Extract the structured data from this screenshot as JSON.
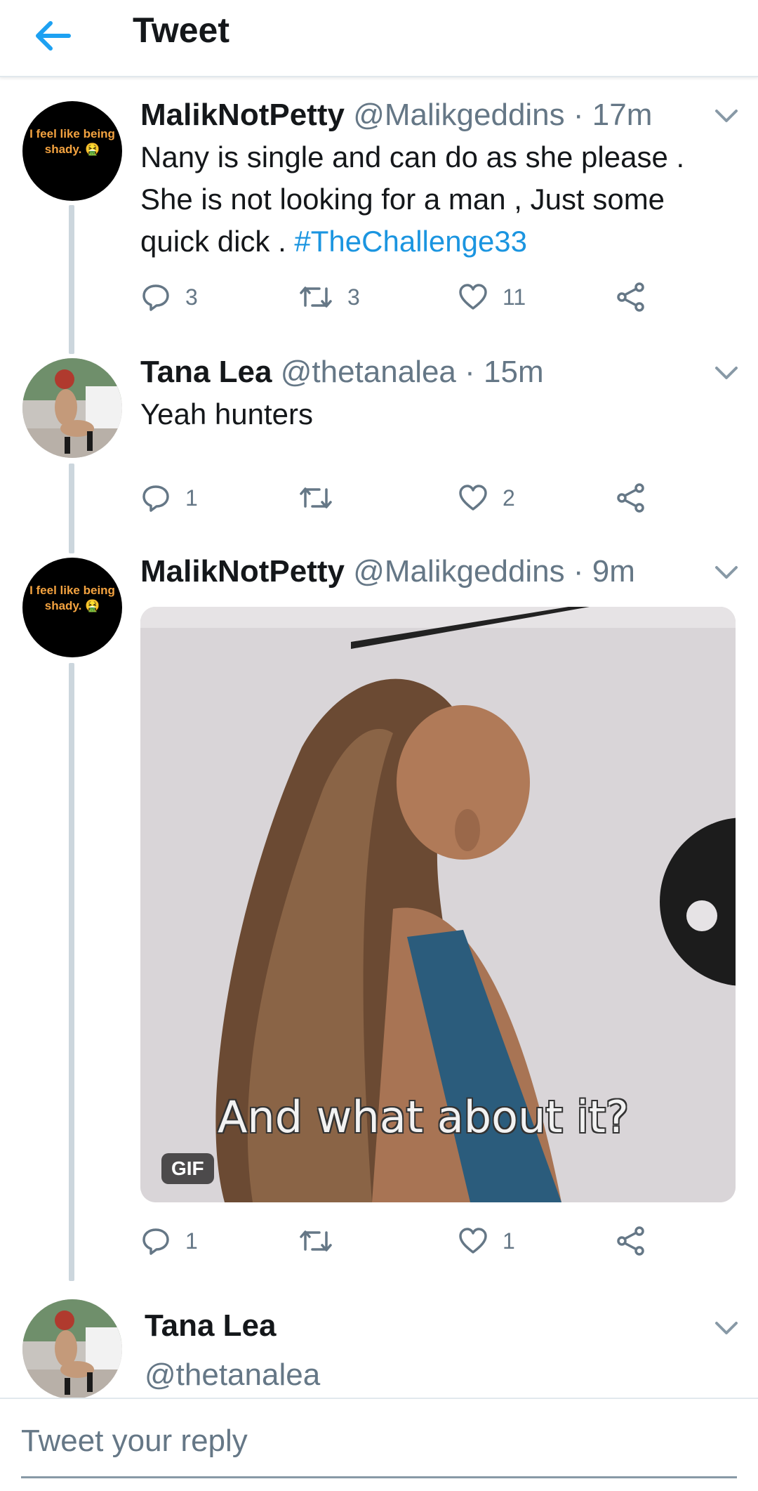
{
  "header": {
    "title": "Tweet",
    "back_icon": "arrow-left-icon",
    "accent": "#1da1f2"
  },
  "tweets": [
    {
      "name": "MalikNotPetty",
      "meta": "@Malikgeddins · 17m",
      "avatar_text": "I feel like being shady. 🤮",
      "text_before": "Nany is single and can do as she please . She is not looking for a man , Just some quick dick . ",
      "hashtag": "#TheChallenge33",
      "replies": "3",
      "retweets": "3",
      "likes": "11"
    },
    {
      "name": "Tana Lea",
      "meta": "@thetanalea · 15m",
      "text": "Yeah hunters",
      "replies": "1",
      "retweets": "",
      "likes": "2"
    },
    {
      "name": "MalikNotPetty",
      "meta": "@Malikgeddins · 9m",
      "avatar_text": "I feel like being shady. 🤮",
      "media": {
        "caption": "And what about it?",
        "badge": "GIF"
      },
      "replies": "1",
      "retweets": "",
      "likes": "1"
    },
    {
      "name": "Tana Lea",
      "handle": "@thetanalea"
    }
  ],
  "reply_bar": {
    "placeholder": "Tweet your reply",
    "value": ""
  },
  "colors": {
    "link": "#1b95e0",
    "secondary_text": "#657786",
    "thread_line": "#ccd6dd"
  }
}
